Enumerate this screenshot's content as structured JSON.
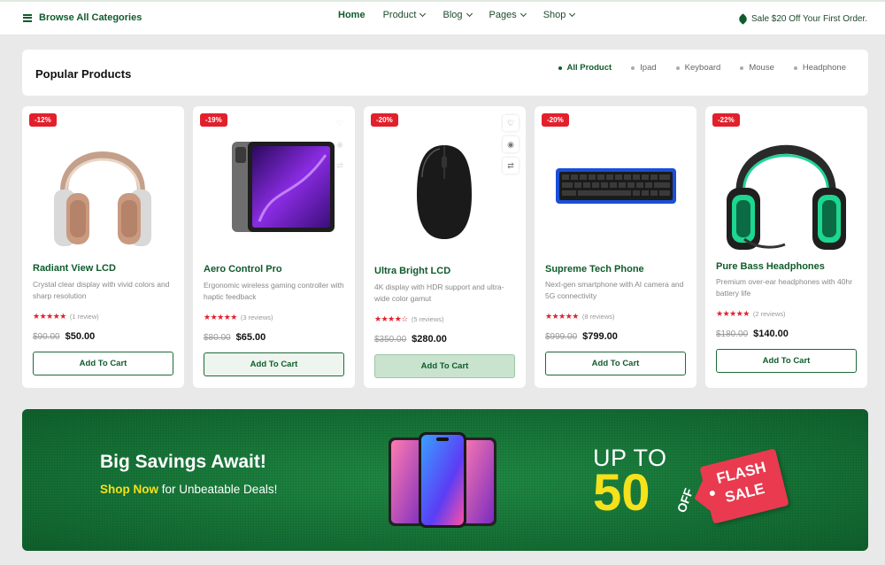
{
  "header": {
    "browse_label": "Browse All Categories",
    "nav": [
      {
        "label": "Home"
      },
      {
        "label": "Product"
      },
      {
        "label": "Blog"
      },
      {
        "label": "Pages"
      },
      {
        "label": "Shop"
      }
    ],
    "promo": "Sale $20 Off Your First Order."
  },
  "popular": {
    "title": "Popular Products",
    "filters": [
      "All Product",
      "Ipad",
      "Keyboard",
      "Mouse",
      "Headphone"
    ],
    "active_filter": "All Product"
  },
  "products": [
    {
      "badge": "-12%",
      "name": "Radiant View LCD",
      "desc": "Crystal clear display with vivid colors and sharp resolution",
      "stars": "★★★★★",
      "reviews": "(1 review)",
      "old_price": "$90.00",
      "price": "$50.00",
      "cart": "Add To Cart",
      "rating": 5
    },
    {
      "badge": "-19%",
      "name": "Aero Control Pro",
      "desc": "Ergonomic wireless gaming controller with haptic feedback",
      "stars": "★★★★★",
      "reviews": "(3 reviews)",
      "old_price": "$80.00",
      "price": "$65.00",
      "cart": "Add To Cart",
      "rating": 4.5
    },
    {
      "badge": "-20%",
      "name": "Ultra Bright LCD",
      "desc": "4K display with HDR support and ultra-wide color gamut",
      "stars": "★★★★☆",
      "reviews": "(5 reviews)",
      "old_price": "$350.00",
      "price": "$280.00",
      "cart": "Add To Cart",
      "rating": 4
    },
    {
      "badge": "-20%",
      "name": "Supreme Tech Phone",
      "desc": "Next-gen smartphone with AI camera and 5G connectivity",
      "stars": "★★★★★",
      "reviews": "(8 reviews)",
      "old_price": "$999.00",
      "price": "$799.00",
      "cart": "Add To Cart",
      "rating": 5
    },
    {
      "badge": "-22%",
      "name": "Pure Bass Headphones",
      "desc": "Premium over-ear headphones with 40hr battery life",
      "stars": "★★★★★",
      "reviews": "(2 reviews)",
      "old_price": "$180.00",
      "price": "$140.00",
      "cart": "Add To Cart",
      "rating": 5
    }
  ],
  "banner": {
    "title": "Big Savings Await!",
    "highlight": "Shop Now",
    "subtitle_rest": " for Unbeatable Deals!",
    "up_to": "UP TO",
    "percent": "50",
    "off": "OFF",
    "flash_line1": "FLASH",
    "flash_line2": "SALE"
  },
  "colors": {
    "brand_green": "#0f5b2b",
    "badge_red": "#e2202b",
    "banner_green": "#167337",
    "banner_yellow": "#f5e11c"
  }
}
